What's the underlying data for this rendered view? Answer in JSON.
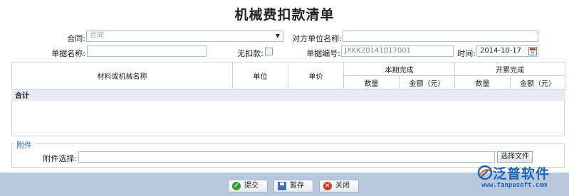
{
  "page_title": "机械费扣款清单",
  "form": {
    "contract_label": "合同:",
    "contract_value": "合同",
    "counterparty_label": "对方单位名称:",
    "counterparty_value": "",
    "doc_name_label": "单据名称:",
    "doc_name_value": "",
    "no_deduct_label": "无扣款:",
    "doc_no_label": "单据编号:",
    "doc_no_value": "JXKK20141017001",
    "time_label": "时间:",
    "time_value": "2014-10-17"
  },
  "table": {
    "col_name": "材料或机械名称",
    "col_unit": "单位",
    "col_price": "单价",
    "group_current": "本期完成",
    "group_cumulative": "开累完成",
    "sub_qty": "数量",
    "sub_amount": "金额（元）",
    "sub_qty2": "数量",
    "sub_amount2": "金额（元）",
    "total_label": "合计"
  },
  "attachment": {
    "legend": "附件",
    "select_label": "附件选择:",
    "file_value": "",
    "browse_button": "选择文件"
  },
  "footer": {
    "submit": "提交",
    "save_draft": "暂存",
    "close": "关闭"
  },
  "logo": {
    "brand": "泛普软件",
    "url": "www.fanpusoft.com"
  },
  "colors": {
    "footer_bg": "#b7c8df",
    "brand_blue": "#1e63b5",
    "input_border": "#a9bdd6"
  }
}
